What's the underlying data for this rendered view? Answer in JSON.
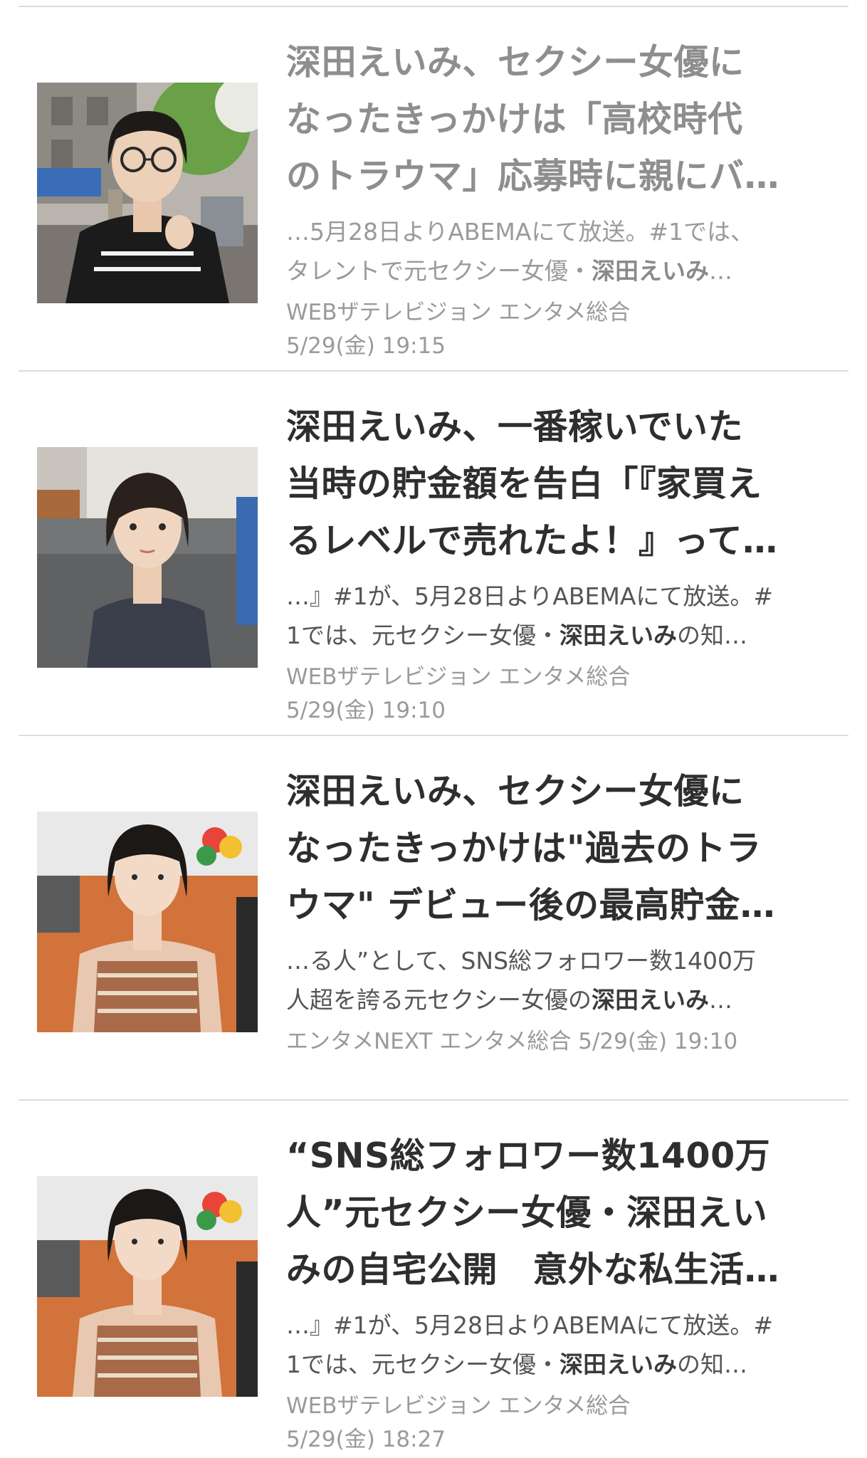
{
  "articles": [
    {
      "title_lines": [
        "深田えいみ、セクシー女優に",
        "なったきっかけは「高校時代",
        "のトラウマ」応募時に親にバ…"
      ],
      "snippet_1_pre": "…5月28日よりABEMAにて放送。#1では、",
      "snippet_2_pre": "タレントで元セクシー女優・",
      "snippet_2_hl": "深田えいみ",
      "snippet_2_post": "…",
      "source": "WEBザテレビジョン エンタメ総合",
      "time": "5/29(金) 19:15"
    },
    {
      "title_lines": [
        "深田えいみ、一番稼いでいた",
        "当時の貯金額を告白「『家買え",
        "るレベルで売れたよ！』って…"
      ],
      "snippet_1_pre": "…』#1が、5月28日よりABEMAにて放送。#",
      "snippet_2_pre": "1では、元セクシー女優・",
      "snippet_2_hl": "深田えいみ",
      "snippet_2_post": "の知…",
      "source": "WEBザテレビジョン エンタメ総合",
      "time": "5/29(金) 19:10"
    },
    {
      "title_lines": [
        "深田えいみ、セクシー女優に",
        "なったきっかけは\"過去のトラ",
        "ウマ\" デビュー後の最高貯金…"
      ],
      "snippet_1_pre": "…る人”として、SNS総フォロワー数1400万",
      "snippet_2_pre": "人超を誇る元セクシー女優の",
      "snippet_2_hl": "深田えいみ",
      "snippet_2_post": "…",
      "source": "エンタメNEXT エンタメ総合",
      "time": "5/29(金) 19:10"
    },
    {
      "title_lines": [
        "“SNS総フォロワー数1400万",
        "人”元セクシー女優・深田えい",
        "みの自宅公開　意外な私生活…"
      ],
      "snippet_1_pre": "…』#1が、5月28日よりABEMAにて放送。#",
      "snippet_2_pre": "1では、元セクシー女優・",
      "snippet_2_hl": "深田えいみ",
      "snippet_2_post": "の知…",
      "source": "WEBザテレビジョン エンタメ総合",
      "time": "5/29(金) 18:27"
    }
  ],
  "icons": {
    "thumb_1": "street-portrait-photo",
    "thumb_2": "living-room-portrait-photo",
    "thumb_3": "interview-portrait-photo",
    "thumb_4": "interview-portrait-photo"
  },
  "colors": {
    "title": "#2e2e2e",
    "title_visited": "#8e8e8e",
    "meta": "#9a9a9a",
    "divider": "#dcdcdc"
  }
}
